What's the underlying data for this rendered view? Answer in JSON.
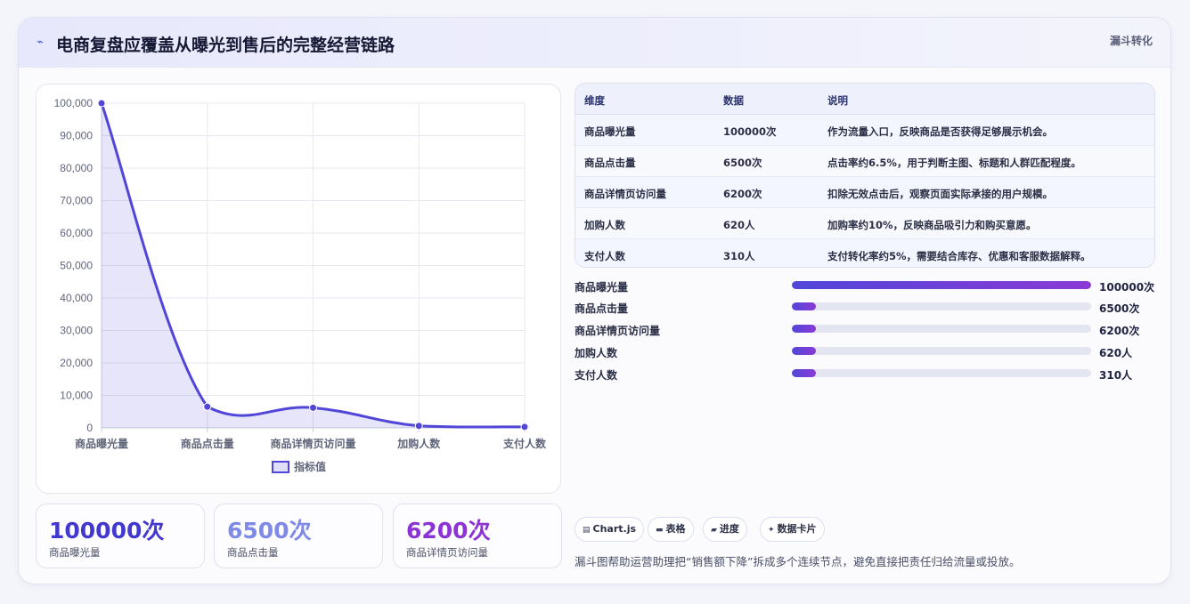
{
  "header": {
    "icon": "wave-icon",
    "title": "电商复盘应覆盖从曝光到售后的完整经营链路",
    "badge": "漏斗转化"
  },
  "chart_data": {
    "type": "line",
    "categories": [
      "商品曝光量",
      "商品点击量",
      "商品详情页访问量",
      "加购人数",
      "支付人数"
    ],
    "series": [
      {
        "name": "指标值",
        "values": [
          100000,
          6500,
          6200,
          620,
          310
        ]
      }
    ],
    "ylim": [
      0,
      100000
    ],
    "yticks": [
      "0",
      "10,000",
      "20,000",
      "30,000",
      "40,000",
      "50,000",
      "60,000",
      "70,000",
      "80,000",
      "90,000",
      "100,000"
    ],
    "area_fill": true,
    "smooth": true,
    "grid": true,
    "legend_position": "bottom",
    "color": "#5146d8"
  },
  "stats": [
    {
      "value": "100000次",
      "label": "商品曝光量",
      "color": "#4238cf"
    },
    {
      "value": "6500次",
      "label": "商品点击量",
      "color": "#7f8ae6"
    },
    {
      "value": "6200次",
      "label": "商品详情页访问量",
      "color": "#8b33d4"
    }
  ],
  "table": {
    "headers": [
      "维度",
      "数据",
      "说明"
    ],
    "rows": [
      [
        "商品曝光量",
        "100000次",
        "作为流量入口，反映商品是否获得足够展示机会。"
      ],
      [
        "商品点击量",
        "6500次",
        "点击率约6.5%，用于判断主图、标题和人群匹配程度。"
      ],
      [
        "商品详情页访问量",
        "6200次",
        "扣除无效点击后，观察页面实际承接的用户规模。"
      ],
      [
        "加购人数",
        "620人",
        "加购率约10%，反映商品吸引力和购买意愿。"
      ],
      [
        "支付人数",
        "310人",
        "支付转化率约5%，需要结合库存、优惠和客服数据解释。"
      ]
    ]
  },
  "progress": [
    {
      "label": "商品曝光量",
      "value": "100000次",
      "fraction": 1.0
    },
    {
      "label": "商品点击量",
      "value": "6500次",
      "fraction": 0.08
    },
    {
      "label": "商品详情页访问量",
      "value": "6200次",
      "fraction": 0.08
    },
    {
      "label": "加购人数",
      "value": "620人",
      "fraction": 0.08
    },
    {
      "label": "支付人数",
      "value": "310人",
      "fraction": 0.08
    }
  ],
  "chips": [
    {
      "icon": "chart-icon",
      "glyph": "▤",
      "label": "Chart.js"
    },
    {
      "icon": "table-icon",
      "glyph": "▬",
      "label": "表格"
    },
    {
      "icon": "progress-icon",
      "glyph": "▰",
      "label": "进度"
    },
    {
      "icon": "sparkle-icon",
      "glyph": "✦",
      "label": "数据卡片"
    }
  ],
  "footer": "漏斗图帮助运营助理把“销售额下降”拆成多个连续节点，避免直接把责任归给流量或投放。"
}
